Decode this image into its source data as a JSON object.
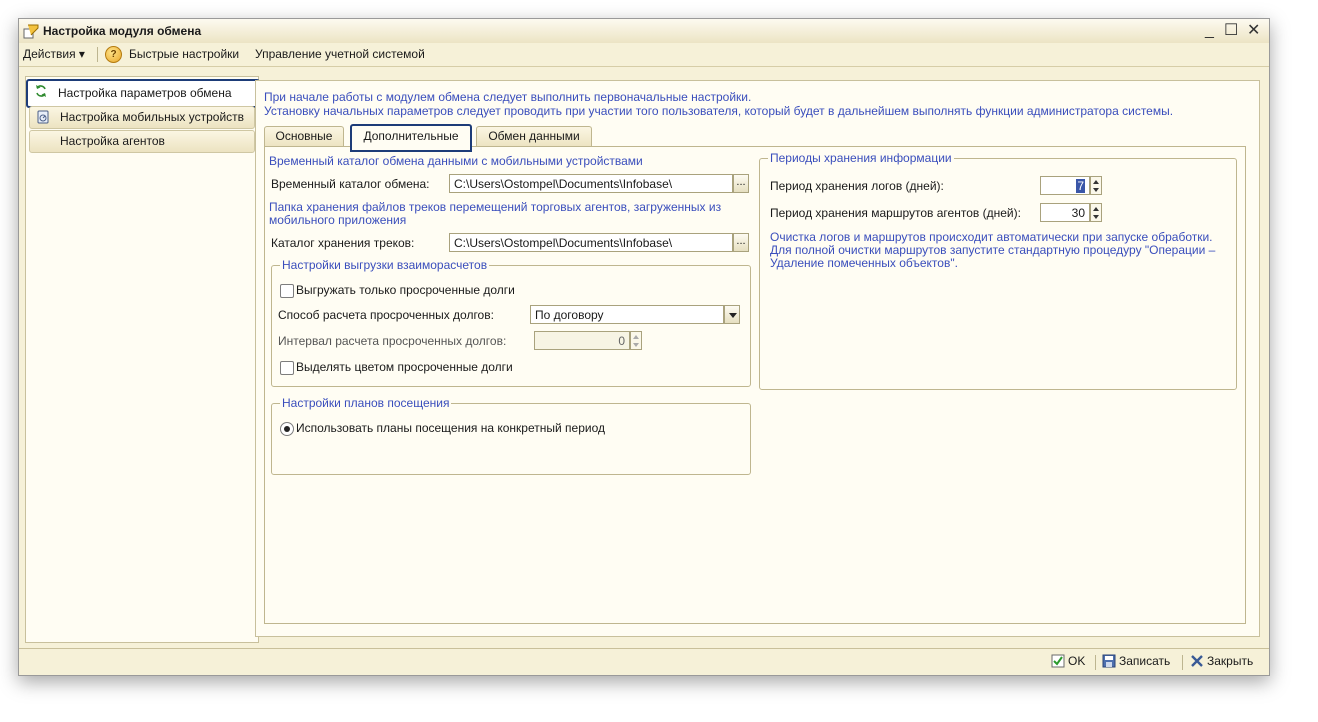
{
  "window": {
    "title": "Настройка модуля обмена",
    "controls": {
      "minimize": "_",
      "maximize": "☐",
      "close": "✕"
    }
  },
  "menu": {
    "actions": "Действия ▾",
    "quick_settings": "Быстрые настройки",
    "manage_accounting": "Управление учетной системой",
    "help_glyph": "?"
  },
  "sidebar": {
    "items": [
      {
        "label": "Настройка параметров обмена",
        "icon": "refresh-icon",
        "active": true
      },
      {
        "label": "Настройка мобильных устройств",
        "icon": "mobile-device-icon",
        "active": false
      },
      {
        "label": "Настройка агентов",
        "icon": "",
        "active": false
      }
    ]
  },
  "main": {
    "info_line1": "При начале работы с модулем обмена следует выполнить первоначальные настройки.",
    "info_line2": "Установку начальных параметров следует проводить при участии того пользователя, который будет в дальнейшем выполнять функции администратора системы.",
    "tabs": [
      {
        "label": "Основные",
        "active": false
      },
      {
        "label": "Дополнительные",
        "active": true
      },
      {
        "label": "Обмен данными",
        "active": false
      }
    ]
  },
  "additional": {
    "temp_dir_header": "Временный каталог обмена данными с мобильными устройствами",
    "temp_dir_label": "Временный каталог обмена:",
    "temp_dir_value": "C:\\Users\\Ostompel\\Documents\\Infobase\\",
    "tracks_header_line1": "Папка хранения файлов треков перемещений торговых агентов, загруженных из",
    "tracks_header_line2": "мобильного приложения",
    "tracks_dir_label": "Каталог хранения треков:",
    "tracks_dir_value": "C:\\Users\\Ostompel\\Documents\\Infobase\\",
    "browse_label": "...",
    "settlements_group": "Настройки выгрузки взаиморасчетов",
    "only_overdue_label": "Выгружать только просроченные долги",
    "only_overdue_checked": false,
    "calc_method_label": "Способ расчета просроченных долгов:",
    "calc_method_value": "По договору",
    "calc_interval_label": "Интервал расчета просроченных долгов:",
    "calc_interval_value": "0",
    "highlight_overdue_label": "Выделять цветом просроченные долги",
    "highlight_overdue_checked": false,
    "visit_group": "Настройки планов посещения",
    "visit_plan_label": "Использовать планы посещения на конкретный период",
    "visit_plan_selected": true,
    "retention_group": "Периоды хранения информации",
    "logs_period_label": "Период хранения логов (дней):",
    "logs_period_value": "7",
    "routes_period_label": "Период хранения маршрутов агентов (дней):",
    "routes_period_value": "30",
    "cleanup_note_line1": "Очистка логов и маршрутов происходит автоматически при запуске обработки.",
    "cleanup_note_line2": "Для полной очистки маршрутов запустите стандартную процедуру \"Операции –",
    "cleanup_note_line3": "Удаление помеченных объектов\"."
  },
  "footer": {
    "ok_label": "OK",
    "save_label": "Записать",
    "close_label": "Закрыть"
  }
}
